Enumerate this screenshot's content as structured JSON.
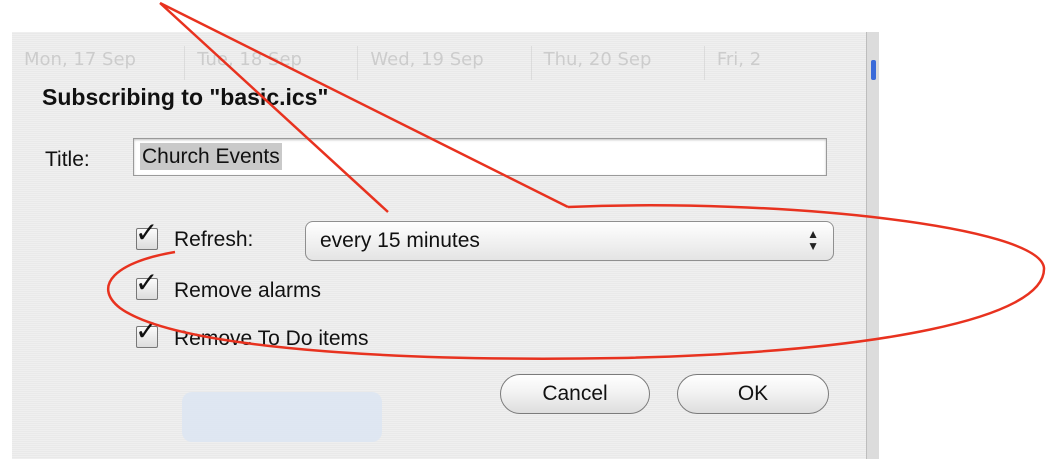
{
  "calendar": {
    "days": [
      "Mon, 17 Sep",
      "Tue, 18 Sep",
      "Wed, 19 Sep",
      "Thu, 20 Sep",
      "Fri, 2"
    ]
  },
  "dialog": {
    "heading": "Subscribing to \"basic.ics\"",
    "title_label": "Title:",
    "title_value": "Church Events",
    "refresh": {
      "label": "Refresh:",
      "checked": true,
      "mark": "✓"
    },
    "refresh_interval": "every 15 minutes",
    "remove_alarms": {
      "label": "Remove alarms",
      "checked": true,
      "mark": "✓"
    },
    "remove_todos": {
      "label": "Remove To Do items",
      "checked": true,
      "mark": "✓"
    },
    "cancel_label": "Cancel",
    "ok_label": "OK"
  },
  "colors": {
    "annotation": "#e8321f",
    "popup_arrows": "up-down-arrows-icon"
  }
}
